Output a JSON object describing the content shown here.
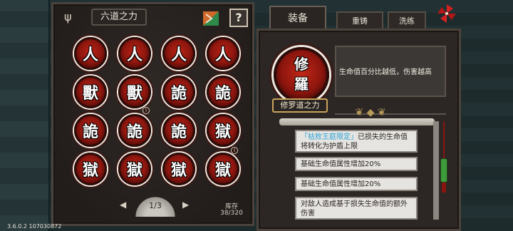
{
  "left_panel": {
    "title": "六道之力",
    "help_label": "?",
    "grid": [
      [
        "人",
        "人",
        "人",
        "人"
      ],
      [
        "獸",
        "獸",
        "詭",
        "詭"
      ],
      [
        "詭",
        "詭",
        "詭",
        "獄"
      ],
      [
        "獄",
        "獄",
        "獄",
        "獄"
      ]
    ],
    "page_indicator": "1/3",
    "stock_label": "库存",
    "stock_value": "38/320"
  },
  "right_panel": {
    "tabs": [
      "装备",
      "重铸",
      "洗练"
    ],
    "selected_glyph_top": "修",
    "selected_glyph_bottom": "羅",
    "item_name": "修罗道之力",
    "effect": "生命值百分比越低，伤害越高",
    "attributes": [
      {
        "highlight": "「枯败王庭限定」",
        "text": "已损失的生命值将转化为护盾上限"
      },
      {
        "highlight": "",
        "text": "基础生命值属性增加20%"
      },
      {
        "highlight": "",
        "text": "基础生命值属性增加20%"
      },
      {
        "highlight": "",
        "text": "对敌人造成基于损失生命值的额外伤害"
      }
    ]
  },
  "version": "3.6.0.2 107030872",
  "colors": {
    "orb_red": "#b92215",
    "highlight_blue": "#2aa4d8",
    "gold": "#c8a35a"
  }
}
